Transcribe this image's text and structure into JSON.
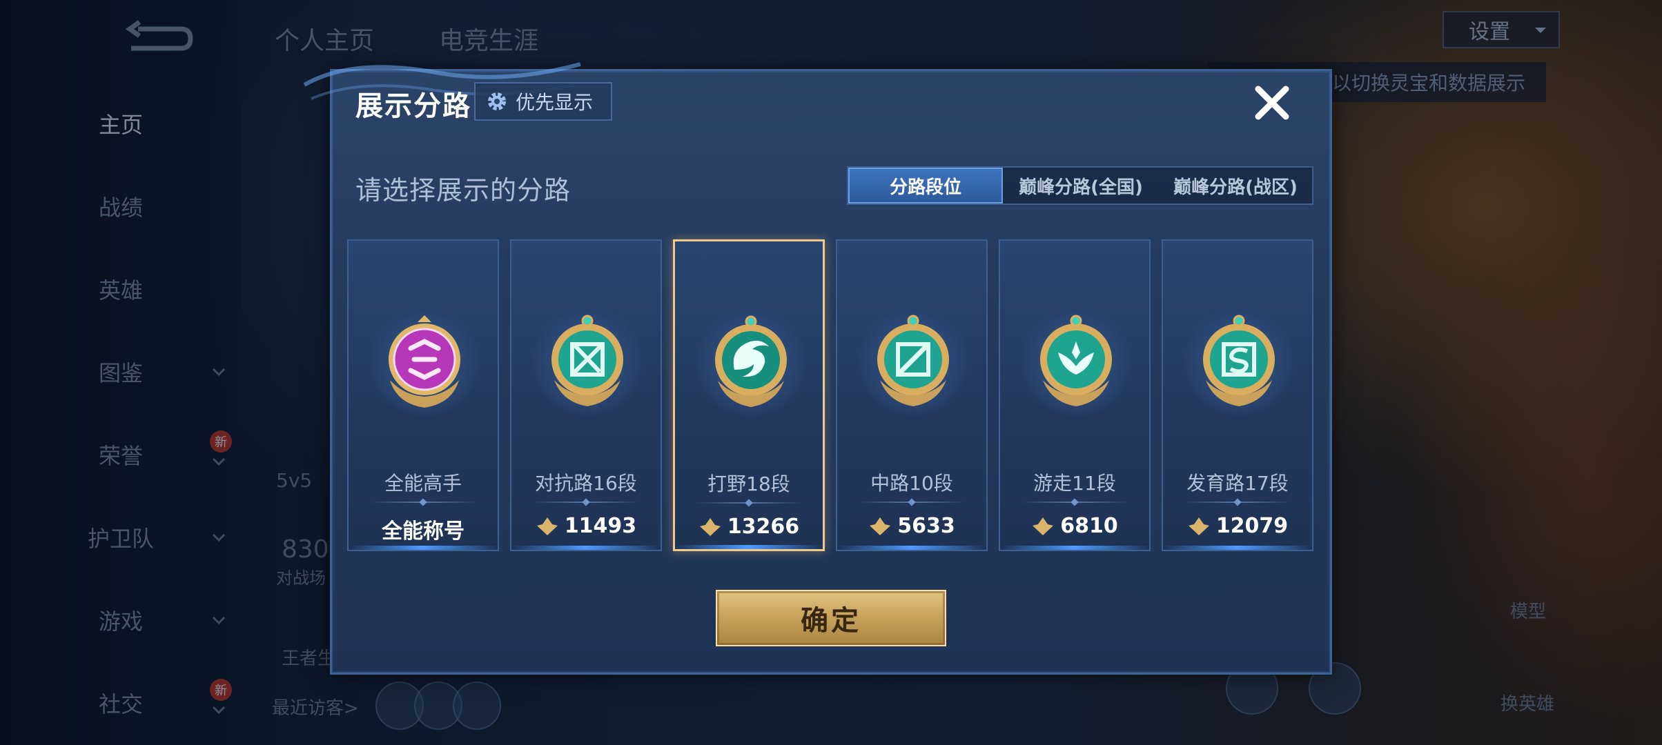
{
  "nav": {
    "items": [
      {
        "label": "主页",
        "active": true
      },
      {
        "label": "战绩"
      },
      {
        "label": "英雄"
      },
      {
        "label": "图鉴",
        "chevron": true
      },
      {
        "label": "荣誉",
        "chevron": true,
        "badge": "新"
      },
      {
        "label": "护卫队",
        "chevron": true
      },
      {
        "label": "游戏",
        "chevron": true
      },
      {
        "label": "社交",
        "chevron": true,
        "badge": "新"
      }
    ]
  },
  "top_tabs": [
    "个人主页",
    "电竞生涯"
  ],
  "settings_label": "设置",
  "bg_hint": "以切换灵宝和数据展示",
  "bg_texts": {
    "visitors": "最近访客>",
    "mode": "5v5",
    "battles_num": "830",
    "battles_label": "对战场",
    "king": "王者生",
    "model": "模型",
    "switch_hero": "换英雄"
  },
  "modal": {
    "title": "展示分路",
    "priority_label": "优先显示",
    "section_title": "请选择展示的分路",
    "tabs": [
      "分路段位",
      "巅峰分路(全国)",
      "巅峰分路(战区)"
    ],
    "active_tab": 0,
    "cards": [
      {
        "name": "全能高手",
        "value": "全能称号",
        "emblem": "all-rounder-emblem-icon",
        "has_points_icon": false
      },
      {
        "name": "对抗路16段",
        "value": "11493",
        "emblem": "clash-lane-emblem-icon",
        "has_points_icon": true
      },
      {
        "name": "打野18段",
        "value": "13266",
        "emblem": "jungle-emblem-icon",
        "has_points_icon": true,
        "selected": true
      },
      {
        "name": "中路10段",
        "value": "5633",
        "emblem": "mid-lane-emblem-icon",
        "has_points_icon": true
      },
      {
        "name": "游走11段",
        "value": "6810",
        "emblem": "roam-emblem-icon",
        "has_points_icon": true
      },
      {
        "name": "发育路17段",
        "value": "12079",
        "emblem": "farm-lane-emblem-icon",
        "has_points_icon": true
      }
    ],
    "confirm_label": "确定"
  },
  "colors": {
    "modal_bg": "#233a5c",
    "accent_blue": "#3f73bd",
    "gold": "#c9a45c",
    "selected_border": "#f0c98c",
    "emblem_teal": "#1fa58f",
    "emblem_purple": "#b03fb8"
  }
}
